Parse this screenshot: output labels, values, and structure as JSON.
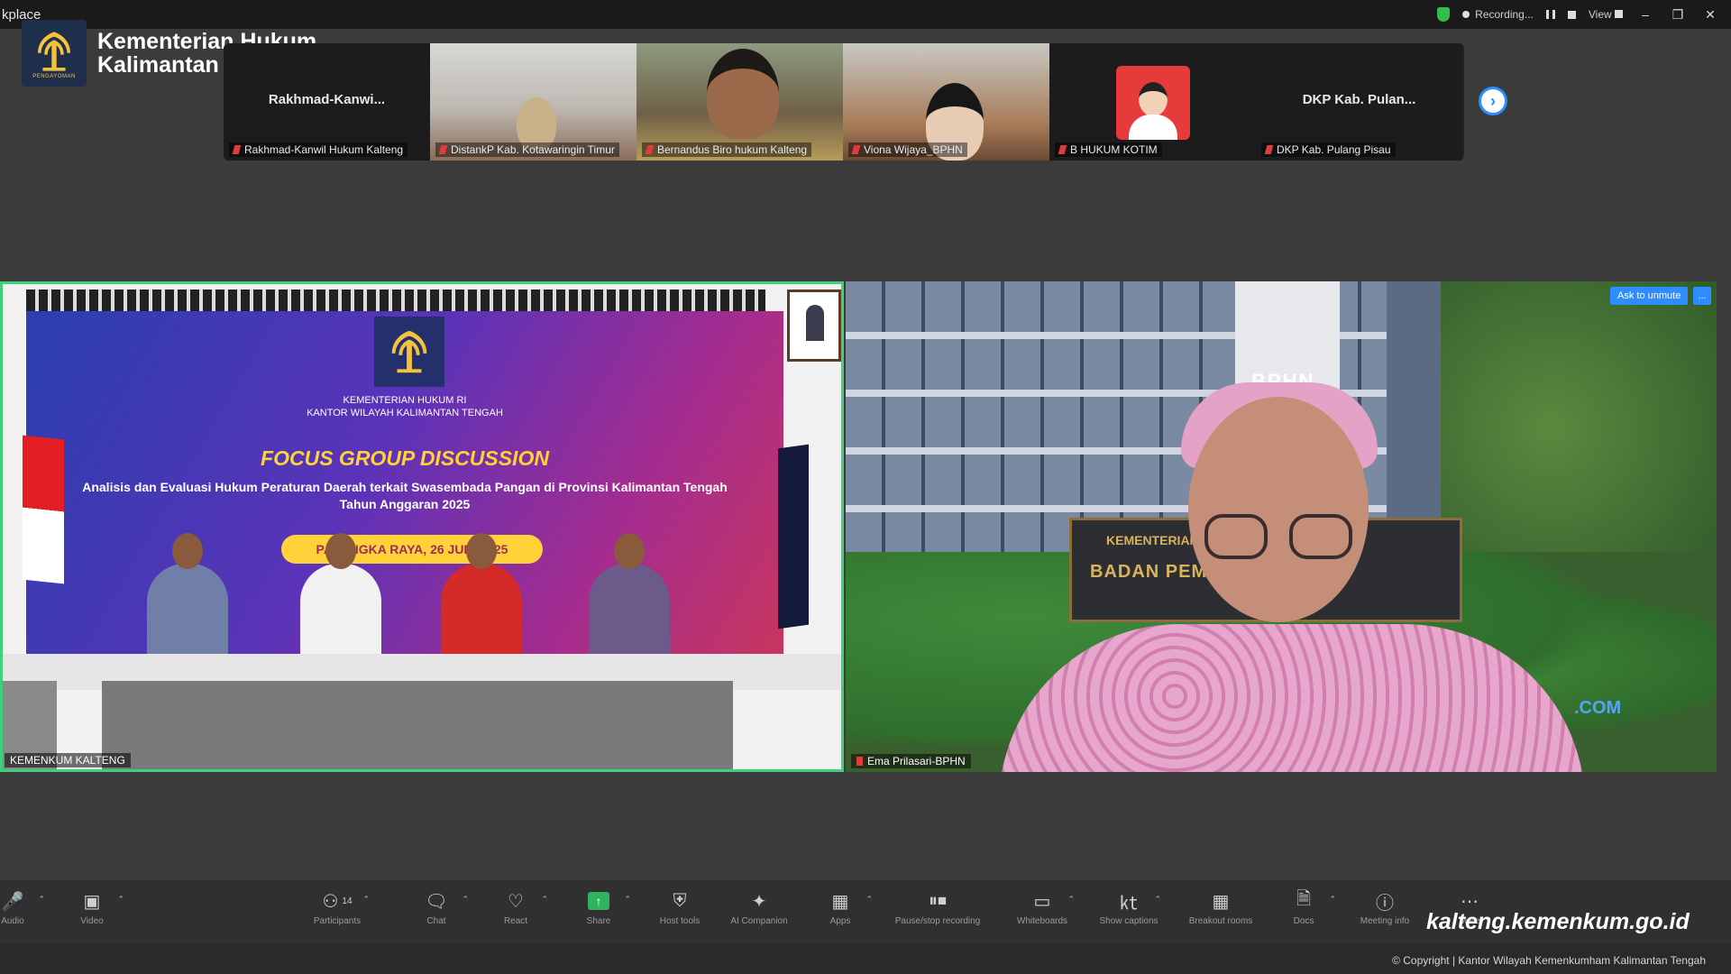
{
  "window": {
    "title": "kplace",
    "recording_label": "Recording...",
    "view_label": "View"
  },
  "brand": {
    "logo_caption": "PENGAYOMAN",
    "line1": "Kementerian Hukum",
    "line2": "Kalimantan Tengah"
  },
  "gallery": [
    {
      "big": "Rakhmad-Kanwi...",
      "name": "Rakhmad-Kanwil Hukum Kalteng"
    },
    {
      "big": "",
      "name": "DistankP Kab. Kotawaringin Timur"
    },
    {
      "big": "",
      "name": "Bernandus Biro hukum Kalteng"
    },
    {
      "big": "",
      "name": "Viona Wijaya_BPHN"
    },
    {
      "big": "",
      "name": "B HUKUM KOTIM"
    },
    {
      "big": "DKP Kab. Pulan...",
      "name": "DKP Kab. Pulang Pisau"
    }
  ],
  "left_video": {
    "org_line1": "KEMENTERIAN HUKUM RI",
    "org_line2": "KANTOR WILAYAH KALIMANTAN TENGAH",
    "title": "FOCUS GROUP DISCUSSION",
    "subtitle_line1": "Analisis dan Evaluasi Hukum Peraturan Daerah terkait Swasembada Pangan di Provinsi Kalimantan Tengah",
    "subtitle_line2": "Tahun Anggaran 2025",
    "date": "PALANGKA RAYA, 26 JUNI 2025",
    "participant_label": "KEMENKUM KALTENG"
  },
  "right_video": {
    "building_text": "BPHN",
    "sign_line1": "KEMENTERIAN",
    "sign_line2": "BADAN PEM            NAL",
    "watermark": ".COM",
    "unmute_button": "Ask to unmute",
    "more_button": "...",
    "participant_label": "Ema Prilasari-BPHN"
  },
  "toolbar": {
    "audio": "Audio",
    "video": "Video",
    "participants": "Participants",
    "participants_count": "14",
    "chat": "Chat",
    "react": "React",
    "share": "Share",
    "host_tools": "Host tools",
    "ai_companion": "AI Companion",
    "apps": "Apps",
    "pause_recording": "Pause/stop recording",
    "whiteboards": "Whiteboards",
    "show_captions": "Show captions",
    "breakout_rooms": "Breakout rooms",
    "docs": "Docs",
    "meeting_info": "Meeting info",
    "more": "More"
  },
  "footer": {
    "url": "kalteng.kemenkum.go.id",
    "copyright": "© Copyright | Kantor Wilayah Kemenkumham Kalimantan Tengah"
  },
  "colors": {
    "accent_blue": "#2d8cff",
    "active_speaker": "#3fd07a",
    "share_green": "#2fb35e",
    "banner_yellow": "#ffd23a"
  }
}
